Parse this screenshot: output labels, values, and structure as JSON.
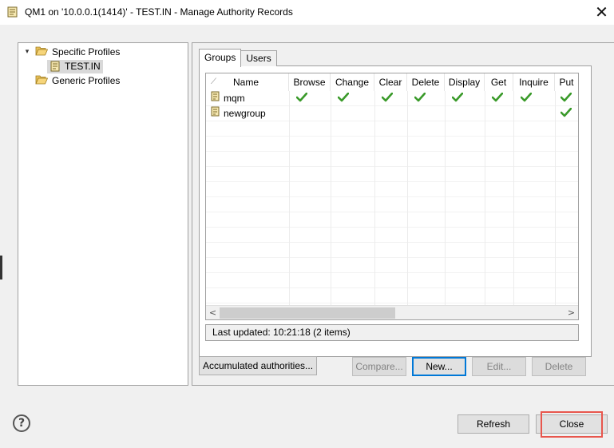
{
  "window": {
    "title": "QM1 on '10.0.0.1(1414)' - TEST.IN - Manage Authority Records",
    "close_glyph": "✕",
    "icon": "authority-records-icon"
  },
  "tree": {
    "items": [
      {
        "label": "Specific Profiles",
        "expanded": true,
        "icon": "folder-open-icon",
        "arrow": "▾"
      },
      {
        "label": "TEST.IN",
        "selected": true,
        "icon": "profile-icon"
      },
      {
        "label": "Generic Profiles",
        "icon": "folder-open-icon"
      }
    ]
  },
  "tabs": [
    {
      "label": "Groups",
      "active": true
    },
    {
      "label": "Users",
      "active": false
    }
  ],
  "table": {
    "sort_glyph": "⟋",
    "columns": [
      "Name",
      "Browse",
      "Change",
      "Clear",
      "Delete",
      "Display",
      "Get",
      "Inquire",
      "Put"
    ],
    "rows": [
      {
        "name": "mqm",
        "checks": [
          true,
          true,
          true,
          true,
          true,
          true,
          true,
          true
        ]
      },
      {
        "name": "newgroup",
        "checks": [
          false,
          false,
          false,
          false,
          false,
          false,
          false,
          true
        ]
      }
    ],
    "scroll_left": "<",
    "scroll_right": ">"
  },
  "status": "Last updated: 10:21:18 (2 items)",
  "buttons": {
    "accumulated": "Accumulated authorities...",
    "compare": "Compare...",
    "new": "New...",
    "edit": "Edit...",
    "delete": "Delete",
    "refresh": "Refresh",
    "close": "Close"
  },
  "help_glyph": "?",
  "colors": {
    "check": "#3a9a2a",
    "highlight": "#e8564d",
    "default_button_border": "#0078d7"
  }
}
